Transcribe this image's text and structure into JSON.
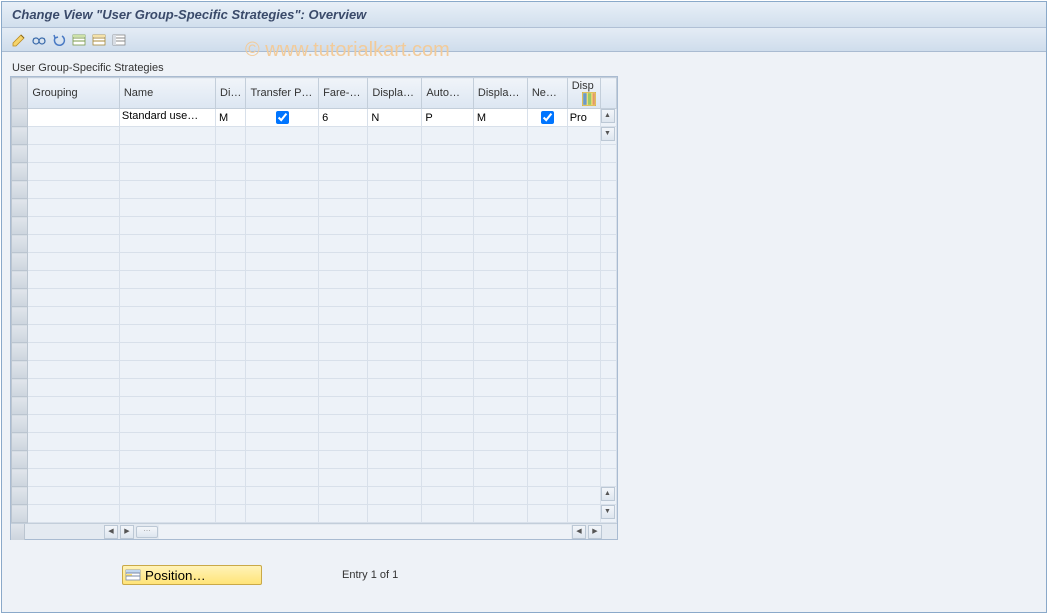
{
  "header": {
    "title": "Change View \"User Group-Specific Strategies\": Overview"
  },
  "watermark": "© www.tutorialkart.com",
  "toolbar": {
    "icons": [
      "change",
      "glasses",
      "undo",
      "new-entries",
      "copy",
      "range"
    ]
  },
  "panel": {
    "title": "User Group-Specific Strategies"
  },
  "table": {
    "columns": {
      "grouping": "Grouping",
      "name": "Name",
      "dis": "Dis…",
      "transfer": "Transfer P…",
      "fared": "Fare-d…",
      "display1": "Display…",
      "autom": "Autom…",
      "display2": "Display…",
      "neg": "Neg…",
      "disp3": "Disp"
    },
    "row": {
      "grouping_value": "",
      "name_value": "Standard use…",
      "dis_value": "M",
      "transfer_checked": true,
      "fared_value": "6",
      "display1_value": "N",
      "autom_value": "P",
      "display2_value": "M",
      "neg_checked": true,
      "disp3_value": "Pro"
    },
    "empty_rows": 22
  },
  "footer": {
    "position_label": "Position…",
    "entry_label": "Entry 1 of 1"
  }
}
